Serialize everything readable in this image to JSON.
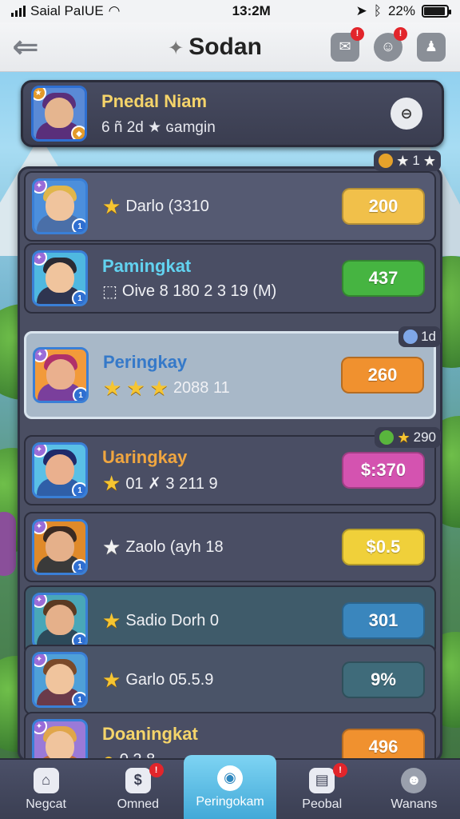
{
  "status": {
    "carrier": "Saial PaIUE",
    "time": "13:2M",
    "battery_text": "22%"
  },
  "nav": {
    "title": "Sodan"
  },
  "header": {
    "name": "Pnedal Niam",
    "sub": "6 ñ 2d ★ ɢamgin"
  },
  "header_badge": {
    "value": "1"
  },
  "rows": [
    {
      "name": "",
      "line": "Darlo (3310",
      "button": "200",
      "button_color": "#f1c04a",
      "name_color": "#ffffff",
      "stars": 1,
      "bg": "#555a72"
    },
    {
      "name": "Pamingkat",
      "line": "Oive 8 180 2 3 19 (M)",
      "button": "437",
      "button_color": "#46b441",
      "name_color": "#62d2f0",
      "stars": 0,
      "bg": "#4a4e64"
    },
    {
      "name": "Peringkay",
      "line": "2088 11",
      "button": "260",
      "button_color": "#f0912f",
      "name_color": "#3579c9",
      "stars": 3,
      "bg": "#a8b8c8"
    },
    {
      "name": "Uaringkay",
      "line": "01 ✗ 3 211 9",
      "button": "$:370",
      "button_color": "#d453b0",
      "name_color": "#f0a640",
      "stars": 1,
      "bg": "#4a4e64"
    },
    {
      "name": "",
      "line": "Zaolo (ayh 18",
      "button": "$0.5",
      "button_color": "#f0d03a",
      "name_color": "#ffffff",
      "stars": 1,
      "bg": "#4a4e64"
    },
    {
      "name": "",
      "line": "Sadio Dorh 0",
      "button": "301",
      "button_color": "#3a86bd",
      "name_color": "#ffffff",
      "stars": 1,
      "bg": "#3f5b6a"
    },
    {
      "name": "",
      "line": "Garlo 05.5.9",
      "button": "9%",
      "button_color": "#3f6b7a",
      "name_color": "#ffffff",
      "stars": 1,
      "bg": "#4a5468"
    },
    {
      "name": "Doaningkat",
      "line": "0 2 8",
      "button": "496",
      "button_color": "#f0912f",
      "name_color": "#f5d46a",
      "stars": 0,
      "bg": "#4a4e64"
    }
  ],
  "row_badges": [
    {
      "value": "1d"
    },
    {
      "value": "290"
    }
  ],
  "tabs": [
    {
      "label": "Negcat",
      "icon": "home-icon",
      "badge": ""
    },
    {
      "label": "Omned",
      "icon": "chat-icon",
      "badge": ""
    },
    {
      "label": "Peringokam",
      "icon": "ranking-icon",
      "badge": ""
    },
    {
      "label": "Peobal",
      "icon": "news-icon",
      "badge": ""
    },
    {
      "label": "Wanans",
      "icon": "profile-icon",
      "badge": ""
    }
  ]
}
